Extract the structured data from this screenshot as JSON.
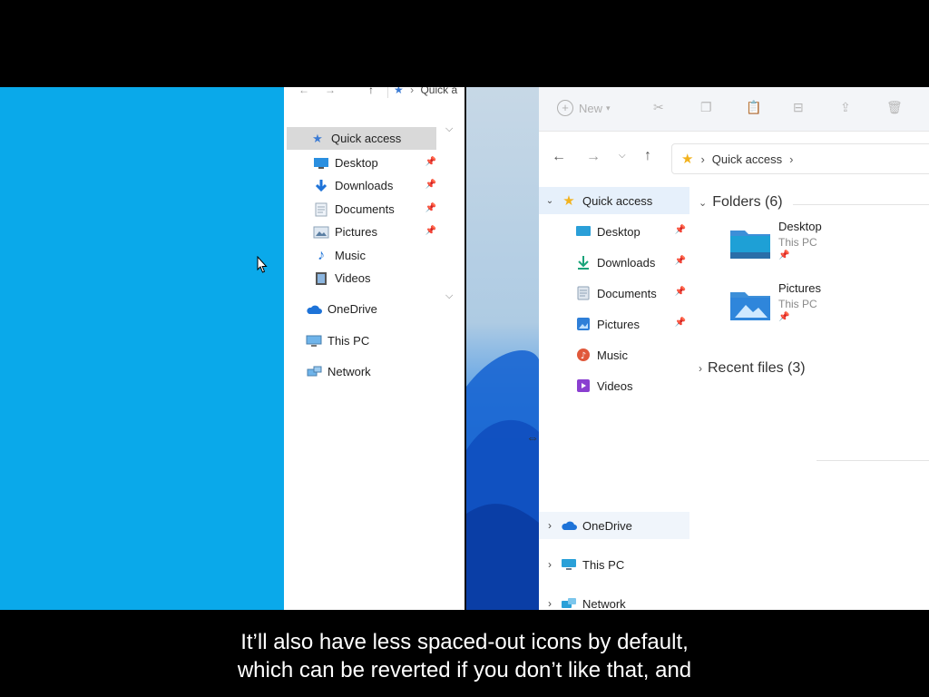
{
  "left_window": {
    "address_crumb": "Quick a",
    "sidebar": [
      {
        "label": "Quick access",
        "icon": "star-icon",
        "pinned": false
      },
      {
        "label": "Desktop",
        "icon": "desktop-icon",
        "pinned": true
      },
      {
        "label": "Downloads",
        "icon": "download-icon",
        "pinned": true
      },
      {
        "label": "Documents",
        "icon": "documents-icon",
        "pinned": true
      },
      {
        "label": "Pictures",
        "icon": "pictures-icon",
        "pinned": true
      },
      {
        "label": "Music",
        "icon": "music-icon",
        "pinned": false
      },
      {
        "label": "Videos",
        "icon": "videos-icon",
        "pinned": false
      },
      {
        "label": "OneDrive",
        "icon": "cloud-icon",
        "pinned": false
      },
      {
        "label": "This PC",
        "icon": "pc-icon",
        "pinned": false
      },
      {
        "label": "Network",
        "icon": "network-icon",
        "pinned": false
      }
    ]
  },
  "right_window": {
    "toolbar": {
      "new_label": "New"
    },
    "breadcrumb": {
      "location": "Quick access"
    },
    "sidebar": [
      {
        "label": "Quick access",
        "icon": "star-icon",
        "expanded": true
      },
      {
        "label": "Desktop",
        "icon": "desktop-icon",
        "pinned": true
      },
      {
        "label": "Downloads",
        "icon": "download-icon",
        "pinned": true
      },
      {
        "label": "Documents",
        "icon": "documents-icon",
        "pinned": true
      },
      {
        "label": "Pictures",
        "icon": "pictures-icon",
        "pinned": true
      },
      {
        "label": "Music",
        "icon": "music-icon",
        "pinned": false
      },
      {
        "label": "Videos",
        "icon": "videos-icon",
        "pinned": false
      },
      {
        "label": "OneDrive",
        "icon": "cloud-icon"
      },
      {
        "label": "This PC",
        "icon": "pc-icon"
      },
      {
        "label": "Network",
        "icon": "network-icon"
      }
    ],
    "folders_header": "Folders (6)",
    "folders": [
      {
        "name": "Desktop",
        "location": "This PC",
        "pinned": true
      },
      {
        "name": "Pictures",
        "location": "This PC",
        "pinned": true
      }
    ],
    "recent_header": "Recent files (3)"
  },
  "subtitles": {
    "line1": "It’ll also have less spaced-out icons by default,",
    "line2": "which can be reverted if you don’t like that, and"
  },
  "colors": {
    "win10_desktop": "#0aa9ea",
    "win11_accent": "#0b6cd0",
    "selection": "#d9d9d9",
    "w11_highlight": "#e6f0fb"
  }
}
